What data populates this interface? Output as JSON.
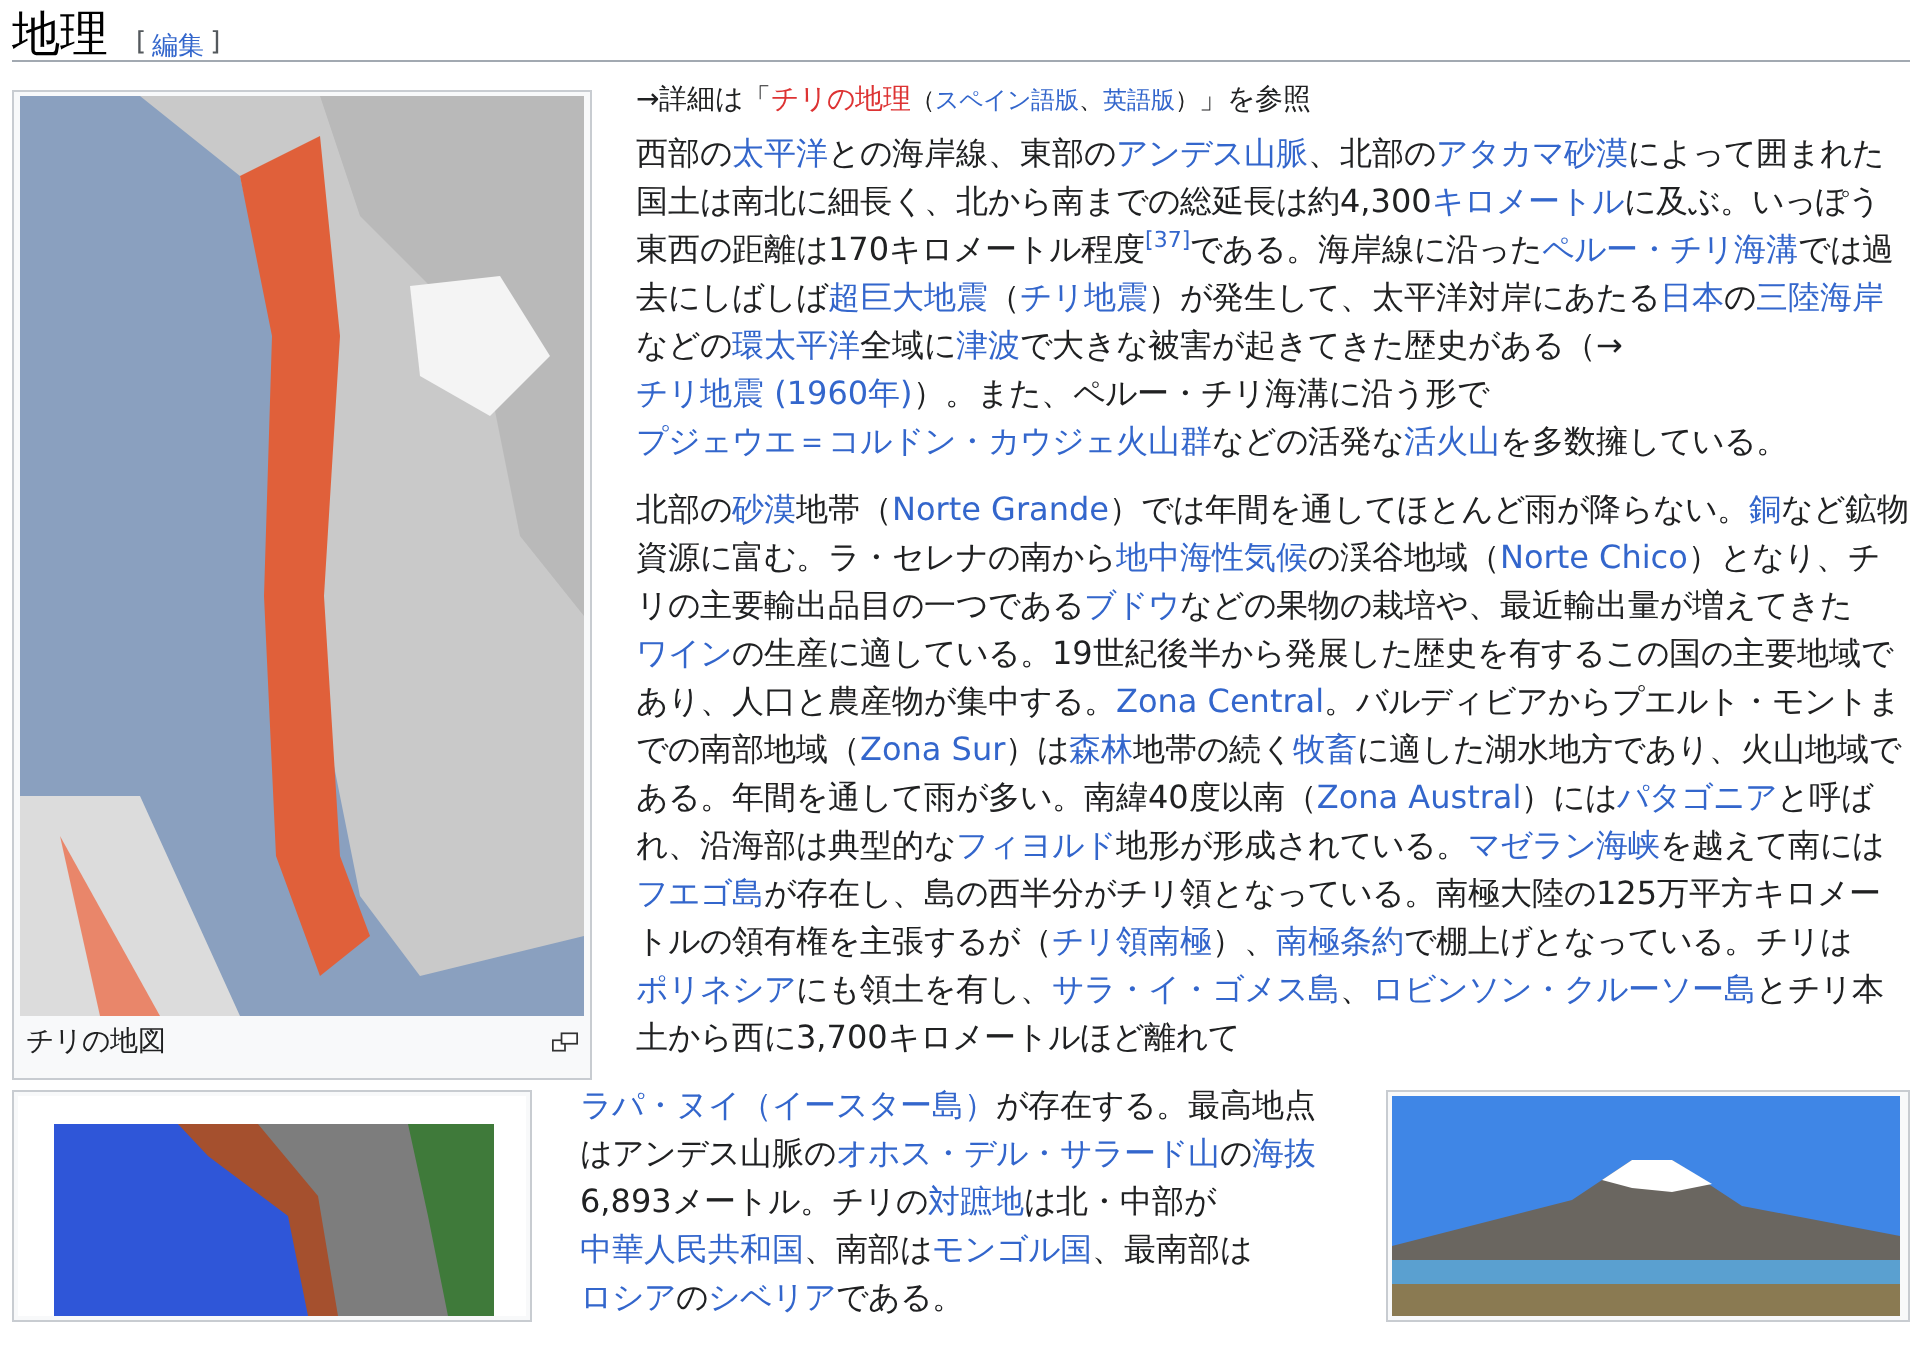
{
  "heading": {
    "title": "地理",
    "edit_brackets": [
      "[",
      "]"
    ],
    "edit_link": "編集"
  },
  "hatnote": [
    {
      "kind": "plain",
      "text": "→詳細は「"
    },
    {
      "kind": "redlink",
      "text": "チリの地理"
    },
    {
      "kind": "small",
      "text": "（"
    },
    {
      "kind": "small-link",
      "text": "スペイン語版"
    },
    {
      "kind": "small",
      "text": "、"
    },
    {
      "kind": "small-link",
      "text": "英語版"
    },
    {
      "kind": "small",
      "text": "）"
    },
    {
      "kind": "plain",
      "text": "」を参照"
    }
  ],
  "figures": [
    {
      "kind": "chile-map",
      "caption": "チリの地図"
    },
    {
      "kind": "relief-map"
    },
    {
      "kind": "volcano-photo"
    }
  ],
  "paragraphs": [
    [
      {
        "kind": "plain",
        "text": "西部の"
      },
      {
        "kind": "link",
        "text": "太平洋"
      },
      {
        "kind": "plain",
        "text": "との海岸線、東部の"
      },
      {
        "kind": "link",
        "text": "アンデス山脈"
      },
      {
        "kind": "plain",
        "text": "、北部の"
      },
      {
        "kind": "link",
        "text": "アタカマ砂漠"
      },
      {
        "kind": "plain",
        "text": "によって囲まれた国土は南北に細長く、北から南までの総延長は約4,300"
      },
      {
        "kind": "link",
        "text": "キロメートル"
      },
      {
        "kind": "plain",
        "text": "に及ぶ。いっぽう東西の距離は170キロメートル程度"
      },
      {
        "kind": "ref",
        "text": "[37]"
      },
      {
        "kind": "plain",
        "text": "である。海岸線に沿った"
      },
      {
        "kind": "link",
        "text": "ペルー・チリ海溝"
      },
      {
        "kind": "plain",
        "text": "では過去にしばしば"
      },
      {
        "kind": "link",
        "text": "超巨大地震"
      },
      {
        "kind": "plain",
        "text": "（"
      },
      {
        "kind": "link",
        "text": "チリ地震"
      },
      {
        "kind": "plain",
        "text": "）が発生して、太平洋対岸にあたる"
      },
      {
        "kind": "link",
        "text": "日本"
      },
      {
        "kind": "plain",
        "text": "の"
      },
      {
        "kind": "link",
        "text": "三陸海岸"
      },
      {
        "kind": "plain",
        "text": "などの"
      },
      {
        "kind": "link",
        "text": "環太平洋"
      },
      {
        "kind": "plain",
        "text": "全域に"
      },
      {
        "kind": "link",
        "text": "津波"
      },
      {
        "kind": "plain",
        "text": "で大きな被害が起きてきた歴史がある（→"
      },
      {
        "kind": "link",
        "text": "チリ地震 (1960年)"
      },
      {
        "kind": "plain",
        "text": "）。また、ペルー・チリ海溝に沿う形で"
      },
      {
        "kind": "link",
        "text": "プジェウエ＝コルドン・カウジェ火山群"
      },
      {
        "kind": "plain",
        "text": "などの活発な"
      },
      {
        "kind": "link",
        "text": "活火山"
      },
      {
        "kind": "plain",
        "text": "を多数擁している。"
      }
    ],
    [
      {
        "kind": "plain",
        "text": "北部の"
      },
      {
        "kind": "link",
        "text": "砂漠"
      },
      {
        "kind": "plain",
        "text": "地帯（"
      },
      {
        "kind": "link",
        "text": "Norte Grande"
      },
      {
        "kind": "plain",
        "text": "）では年間を通してほとんど雨が降らない。"
      },
      {
        "kind": "link",
        "text": "銅"
      },
      {
        "kind": "plain",
        "text": "など鉱物資源に富む。ラ・セレナの南から"
      },
      {
        "kind": "link",
        "text": "地中海性気候"
      },
      {
        "kind": "plain",
        "text": "の渓谷地域（"
      },
      {
        "kind": "link",
        "text": "Norte Chico"
      },
      {
        "kind": "plain",
        "text": "）となり、チリの主要輸出品目の一つである"
      },
      {
        "kind": "link",
        "text": "ブドウ"
      },
      {
        "kind": "plain",
        "text": "などの果物の栽培や、最近輸出量が増えてきた"
      },
      {
        "kind": "link",
        "text": "ワイン"
      },
      {
        "kind": "plain",
        "text": "の生産に適している。19世紀後半から発展した歴史を有するこの国の主要地域であり、人口と農産物が集中する。"
      },
      {
        "kind": "link",
        "text": "Zona Central"
      },
      {
        "kind": "plain",
        "text": "。バルディビアからプエルト・モントまでの南部地域（"
      },
      {
        "kind": "link",
        "text": "Zona Sur"
      },
      {
        "kind": "plain",
        "text": "）は"
      },
      {
        "kind": "link",
        "text": "森林"
      },
      {
        "kind": "plain",
        "text": "地帯の続く"
      },
      {
        "kind": "link",
        "text": "牧畜"
      },
      {
        "kind": "plain",
        "text": "に適した湖水地方であり、火山地域である。年間を通して雨が多い。南緯40度以南（"
      },
      {
        "kind": "link",
        "text": "Zona Austral"
      },
      {
        "kind": "plain",
        "text": "）には"
      },
      {
        "kind": "link",
        "text": "パタゴニア"
      },
      {
        "kind": "plain",
        "text": "と呼ばれ、沿海部は典型的な"
      },
      {
        "kind": "link",
        "text": "フィヨルド"
      },
      {
        "kind": "plain",
        "text": "地形が形成されている。"
      },
      {
        "kind": "link",
        "text": "マゼラン海峡"
      },
      {
        "kind": "plain",
        "text": "を越えて南には"
      },
      {
        "kind": "link",
        "text": "フエゴ島"
      },
      {
        "kind": "plain",
        "text": "が存在し、島の西半分がチリ領となっている。南極大陸の125万平方キロメートルの領有権を主張するが（"
      },
      {
        "kind": "link",
        "text": "チリ領南極"
      },
      {
        "kind": "plain",
        "text": "）、"
      },
      {
        "kind": "link",
        "text": "南極条約"
      },
      {
        "kind": "plain",
        "text": "で棚上げとなっている。チリは"
      },
      {
        "kind": "link",
        "text": "ポリネシア"
      },
      {
        "kind": "plain",
        "text": "にも領土を有し、"
      },
      {
        "kind": "link",
        "text": "サラ・イ・ゴメス島"
      },
      {
        "kind": "plain",
        "text": "、"
      },
      {
        "kind": "link",
        "text": "ロビンソン・クルーソー島"
      },
      {
        "kind": "plain",
        "text": "とチリ本土から西に3,700キロメートルほど離れて"
      }
    ],
    [
      {
        "kind": "link",
        "text": "ラパ・ヌイ（イースター島）"
      },
      {
        "kind": "plain",
        "text": "が存在する。最高地点はアンデス山脈の"
      },
      {
        "kind": "link",
        "text": "オホス・デル・サラード山"
      },
      {
        "kind": "plain",
        "text": "の"
      },
      {
        "kind": "link",
        "text": "海抜"
      },
      {
        "kind": "plain",
        "text": "6,893メートル。チリの"
      },
      {
        "kind": "link",
        "text": "対蹠地"
      },
      {
        "kind": "plain",
        "text": "は北・中部が"
      },
      {
        "kind": "link",
        "text": "中華人民共和国"
      },
      {
        "kind": "plain",
        "text": "、南部は"
      },
      {
        "kind": "link",
        "text": "モンゴル国"
      },
      {
        "kind": "plain",
        "text": "、最南部は"
      },
      {
        "kind": "link",
        "text": "ロシア"
      },
      {
        "kind": "plain",
        "text": "の"
      },
      {
        "kind": "link",
        "text": "シベリア"
      },
      {
        "kind": "plain",
        "text": "である。"
      }
    ]
  ]
}
